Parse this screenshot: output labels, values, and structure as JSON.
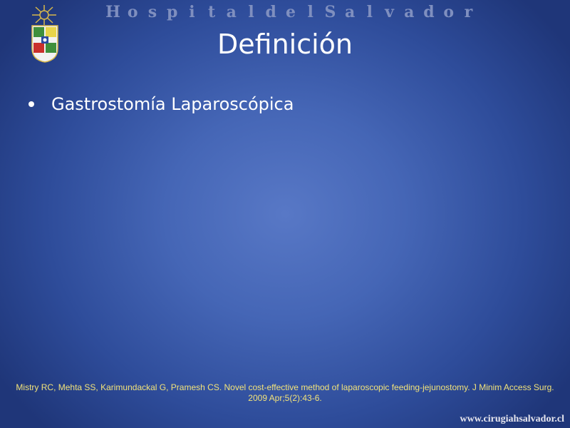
{
  "slide": {
    "header_text": "Hospital del Salvador",
    "title": "Definición",
    "bullets": [
      {
        "text": "Gastrostomía Laparoscópica"
      }
    ],
    "citation": "Mistry RC, Mehta SS, Karimundackal G, Pramesh CS. Novel cost-effective method of laparoscopic feeding-jejunostomy. J Minim Access Surg. 2009 Apr;5(2):43-6.",
    "website": "www.cirugiahsalvador.cl"
  },
  "icons": {
    "sun": "sun-emblem-icon",
    "crest": "university-crest-icon"
  },
  "colors": {
    "background_center": "#5878c6",
    "background_edge": "#1f3679",
    "header_text": "#7f8fbf",
    "title_text": "#ffffff",
    "citation_text": "#f2e37a"
  }
}
